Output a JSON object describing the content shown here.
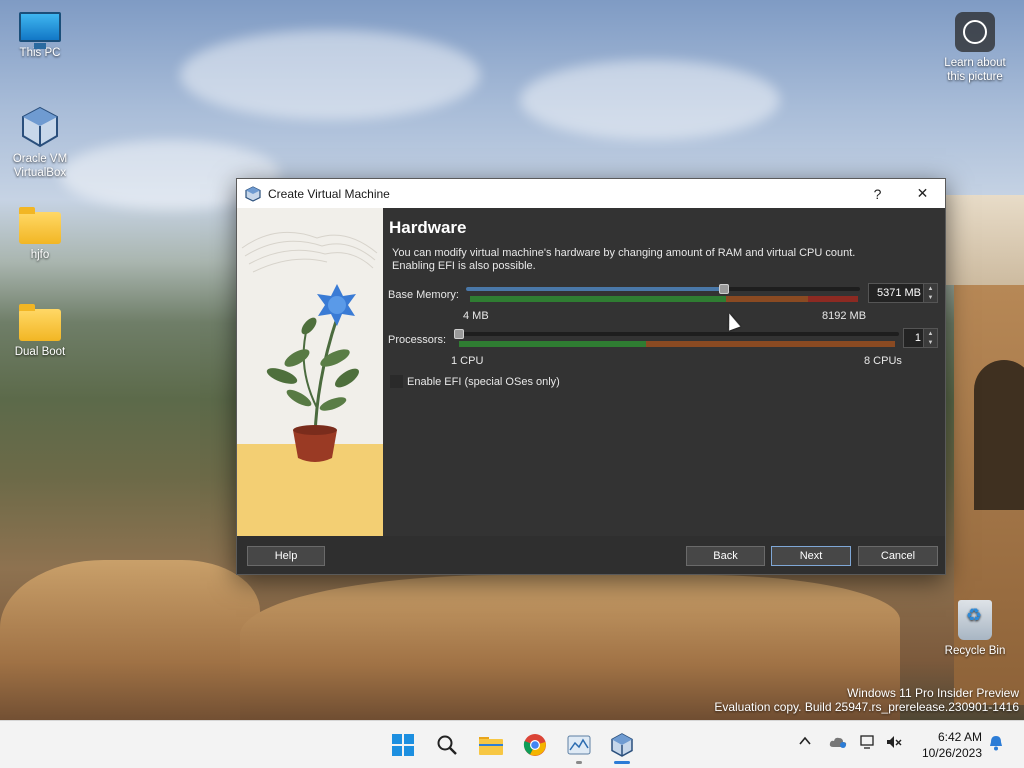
{
  "desktop": {
    "icons": [
      {
        "label": "This PC",
        "icon": "monitor-icon"
      },
      {
        "label": "Oracle VM VirtualBox",
        "icon": "virtualbox-icon"
      },
      {
        "label": "hjfo",
        "icon": "folder-icon"
      },
      {
        "label": "Dual Boot",
        "icon": "folder-icon"
      }
    ],
    "learn_about": "Learn about this picture",
    "recycle_bin": "Recycle Bin",
    "watermark_line1": "Windows 11 Pro Insider Preview",
    "watermark_line2": "Evaluation copy. Build 25947.rs_prerelease.230901-1416"
  },
  "dialog": {
    "title": "Create Virtual Machine",
    "help_icon": "?",
    "close_icon": "✕",
    "heading": "Hardware",
    "description": "You can modify virtual machine's hardware by changing amount of RAM and virtual CPU count. Enabling EFI is also possible.",
    "memory": {
      "label": "Base Memory:",
      "value": "5371 MB",
      "min_label": "4 MB",
      "max_label": "8192 MB",
      "level": 0.655
    },
    "processors": {
      "label": "Processors:",
      "value": "1",
      "min_label": "1 CPU",
      "max_label": "8 CPUs",
      "level": 0.0
    },
    "efi": {
      "label": "Enable EFI (special OSes only)",
      "checked": false
    },
    "buttons": {
      "help": "Help",
      "back": "Back",
      "next": "Next",
      "cancel": "Cancel"
    }
  },
  "taskbar": {
    "apps": [
      "windows-start-icon",
      "search-icon",
      "file-explorer-icon",
      "chrome-icon",
      "photos-icon",
      "virtualbox-icon"
    ],
    "time": "6:42 AM",
    "date": "10/26/2023"
  },
  "colors": {
    "good": "#2f7d32",
    "warn": "#8a4a22",
    "danger": "#8c2a22",
    "accent": "#2c7cd6"
  }
}
